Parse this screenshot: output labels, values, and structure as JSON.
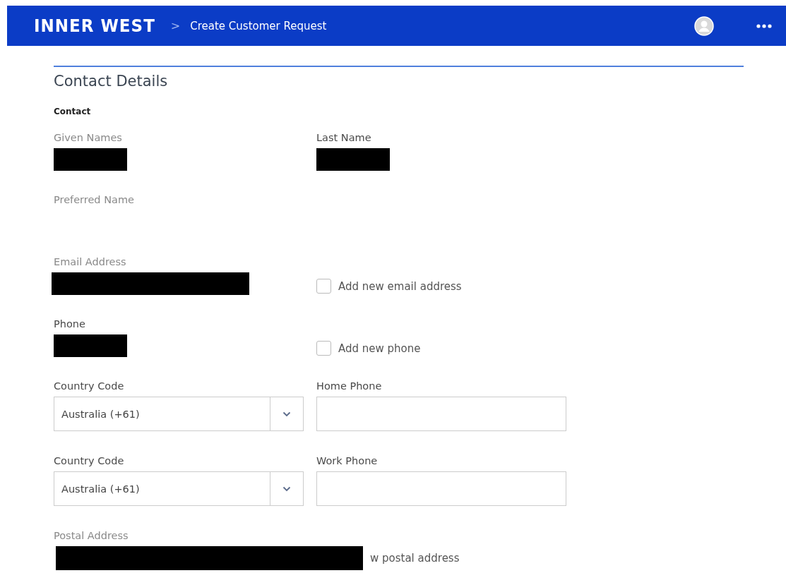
{
  "header": {
    "logo": "INNER WEST",
    "separator": ">",
    "title": "Create Customer Request"
  },
  "section": {
    "title": "Contact Details",
    "subtitle": "Contact"
  },
  "rows": [
    {
      "kind": "display",
      "cells": [
        {
          "kind": "display",
          "label": "Given Names",
          "muted": true,
          "redacted": true
        },
        {
          "kind": "display",
          "label": "Last Name",
          "muted": false,
          "redacted": true
        }
      ]
    },
    {
      "kind": "display",
      "cells": [
        {
          "kind": "display",
          "label": "Preferred Name",
          "muted": true,
          "redacted": false
        }
      ]
    },
    {
      "kind": "display",
      "cells": [
        {
          "kind": "display",
          "label": "Email Address",
          "muted": true,
          "redacted": true
        },
        {
          "kind": "checkbox",
          "label": "Add new email address",
          "checked": false
        }
      ]
    },
    {
      "kind": "display",
      "cells": [
        {
          "kind": "display",
          "label": "Phone",
          "muted": false,
          "redacted": true
        },
        {
          "kind": "checkbox",
          "label": "Add new phone",
          "checked": false
        }
      ]
    },
    {
      "kind": "control",
      "cells": [
        {
          "kind": "select",
          "label": "Country Code",
          "muted": false,
          "value": "Australia (+61)"
        },
        {
          "kind": "input",
          "label": "Home Phone",
          "muted": false
        }
      ]
    },
    {
      "kind": "control",
      "cells": [
        {
          "kind": "select",
          "label": "Country Code",
          "muted": false,
          "value": "Australia (+61)"
        },
        {
          "kind": "input",
          "label": "Work Phone",
          "muted": false
        }
      ]
    },
    {
      "kind": "wide",
      "cells": [
        {
          "kind": "display",
          "label": "Postal Address",
          "muted": true,
          "redacted": true
        },
        {
          "kind": "note",
          "text": "w postal address"
        }
      ]
    }
  ]
}
